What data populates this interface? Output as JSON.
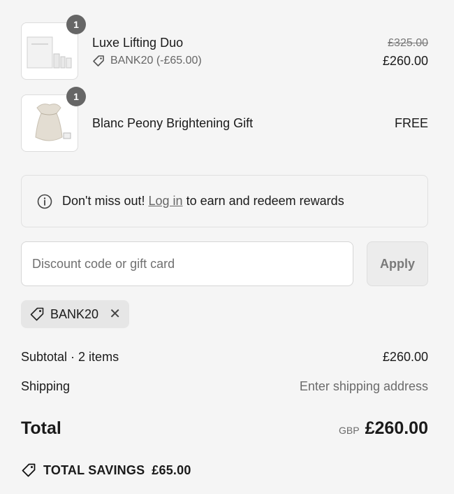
{
  "line_items": [
    {
      "quantity": "1",
      "title": "Luxe Lifting Duo",
      "discount_code": "BANK20 (-£65.00)",
      "original_price": "£325.00",
      "price": "£260.00",
      "thumb_icon": "skincare-box-image"
    },
    {
      "quantity": "1",
      "title": "Blanc Peony Brightening Gift",
      "price": "FREE",
      "thumb_icon": "pouch-image"
    }
  ],
  "rewards_banner": {
    "prefix": "Don't miss out!",
    "link": "Log in",
    "suffix": "to earn and redeem rewards"
  },
  "discount": {
    "placeholder": "Discount code or gift card",
    "value": "",
    "apply_label": "Apply",
    "applied_code": "BANK20"
  },
  "summary": {
    "subtotal_label": "Subtotal · 2 items",
    "subtotal_value": "£260.00",
    "shipping_label": "Shipping",
    "shipping_value": "Enter shipping address",
    "total_label": "Total",
    "total_currency": "GBP",
    "total_value": "£260.00",
    "savings_label": "TOTAL SAVINGS",
    "savings_value": "£65.00"
  },
  "colors": {
    "background": "#f5f5f5",
    "badge": "#666666",
    "text": "#1a1a1a",
    "muted": "#6b6b6b"
  }
}
